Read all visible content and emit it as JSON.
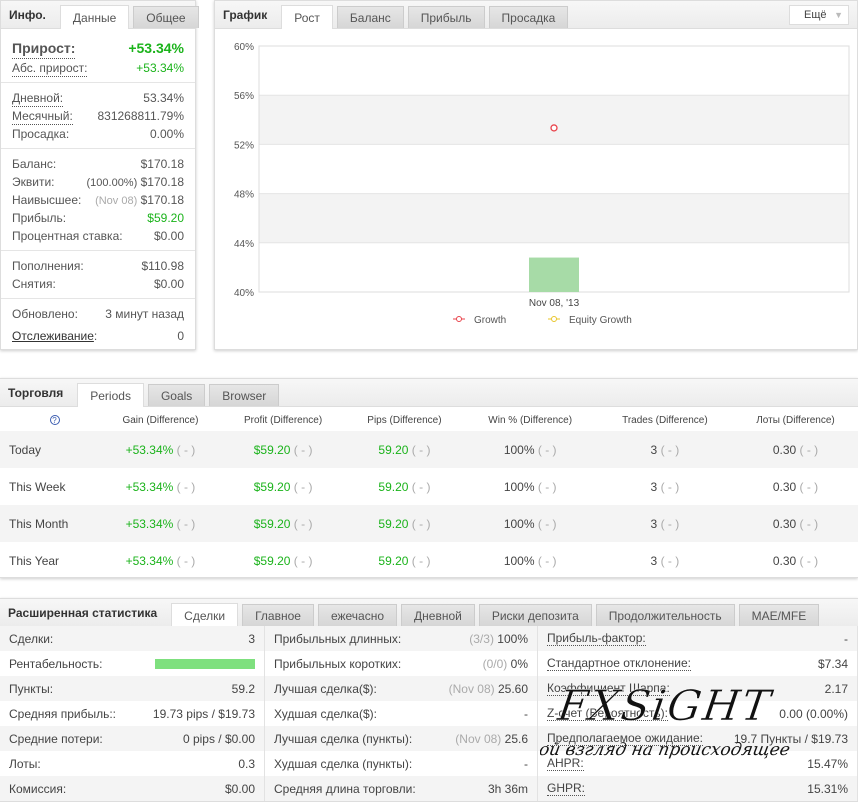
{
  "info": {
    "title": "Инфо.",
    "tabs": [
      "Данные",
      "Общее"
    ],
    "growth_label": "Прирост:",
    "growth_value": "+53.34%",
    "abs_label": "Абс. прирост:",
    "abs_value": "+53.34%",
    "rows1": [
      {
        "l": "Дневной:",
        "v": "53.34%"
      },
      {
        "l": "Месячный:",
        "v": "831268811.79%"
      },
      {
        "l": "Просадка:",
        "v": "0.00%"
      }
    ],
    "balance_label": "Баланс:",
    "balance": "$170.18",
    "equity_label": "Эквити:",
    "equity_pct": "(100.00%)",
    "equity": "$170.18",
    "high_label": "Наивысшее:",
    "high_date": "(Nov 08)",
    "high": "$170.18",
    "profit_label": "Прибыль:",
    "profit": "$59.20",
    "interest_label": "Процентная ставка:",
    "interest": "$0.00",
    "deposits_label": "Пополнения:",
    "deposits": "$110.98",
    "withdrawals_label": "Снятия:",
    "withdrawals": "$0.00",
    "updated_label": "Обновлено:",
    "updated": "3 минут назад",
    "tracking_label": "Отслеживание",
    "tracking": "0"
  },
  "chart": {
    "title": "График",
    "tabs": [
      "Рост",
      "Баланс",
      "Прибыль",
      "Просадка"
    ],
    "more": "Ещё"
  },
  "chart_data": {
    "type": "line",
    "yticks": [
      "60%",
      "56%",
      "52%",
      "48%",
      "44%",
      "40%"
    ],
    "ylim": [
      40,
      60
    ],
    "categories": [
      "Nov 08, '13"
    ],
    "series": [
      {
        "name": "Growth",
        "values": [
          53.34
        ],
        "color": "#e8424a"
      },
      {
        "name": "Equity Growth",
        "values": [],
        "color": "#e8c52a"
      }
    ],
    "bar": {
      "value": 42.8,
      "color": "#a7dba7"
    }
  },
  "trading": {
    "title": "Торговля",
    "tabs": [
      "Periods",
      "Goals",
      "Browser"
    ],
    "help": "?",
    "headers": [
      "Gain (Difference)",
      "Profit (Difference)",
      "Pips (Difference)",
      "Win % (Difference)",
      "Trades (Difference)",
      "Лоты (Difference)"
    ],
    "diff": "( - )",
    "rows": [
      {
        "period": "Today",
        "gain": "+53.34%",
        "profit": "$59.20",
        "pips": "59.20",
        "win": "100%",
        "trades": "3",
        "lots": "0.30"
      },
      {
        "period": "This Week",
        "gain": "+53.34%",
        "profit": "$59.20",
        "pips": "59.20",
        "win": "100%",
        "trades": "3",
        "lots": "0.30"
      },
      {
        "period": "This Month",
        "gain": "+53.34%",
        "profit": "$59.20",
        "pips": "59.20",
        "win": "100%",
        "trades": "3",
        "lots": "0.30"
      },
      {
        "period": "This Year",
        "gain": "+53.34%",
        "profit": "$59.20",
        "pips": "59.20",
        "win": "100%",
        "trades": "3",
        "lots": "0.30"
      }
    ]
  },
  "ext": {
    "title": "Расширенная статистика",
    "tabs": [
      "Сделки",
      "Главное",
      "ежечасно",
      "Дневной",
      "Риски депозита",
      "Продолжительность",
      "MAE/MFE"
    ],
    "col1": [
      {
        "l": "Сделки:",
        "v": "3"
      },
      {
        "l": "Рентабельность:",
        "bar": 1.0
      },
      {
        "l": "Пункты:",
        "v": "59.2"
      },
      {
        "l": "Средняя прибыль::",
        "v": "19.73 pips / $19.73"
      },
      {
        "l": "Средние потери:",
        "v": "0 pips / $0.00"
      },
      {
        "l": "Лоты:",
        "v": "0.3"
      },
      {
        "l": "Комиссия:",
        "v": "$0.00"
      }
    ],
    "col2": [
      {
        "l": "Прибыльных длинных:",
        "m": "(3/3)",
        "v": "100%"
      },
      {
        "l": "Прибыльных коротких:",
        "m": "(0/0)",
        "v": "0%"
      },
      {
        "l": "Лучшая сделка($):",
        "m": "(Nov 08)",
        "v": "25.60"
      },
      {
        "l": "Худшая сделка($):",
        "v": "-"
      },
      {
        "l": "Лучшая сделка (пункты):",
        "m": "(Nov 08)",
        "v": "25.6"
      },
      {
        "l": "Худшая сделка (пункты):",
        "v": "-"
      },
      {
        "l": "Средняя длина торговли:",
        "v": "3h 36m"
      }
    ],
    "col3": [
      {
        "l": "Прибыль-фактор:",
        "v": "-"
      },
      {
        "l": "Стандартное отклонение:",
        "v": "$7.34"
      },
      {
        "l": "Коэффициент Шарпа:",
        "v": "2.17"
      },
      {
        "l": "Z-счет (Вероятность):",
        "v": "0.00 (0.00%)"
      },
      {
        "l": "Предполагаемое ожидание:",
        "v": "19.7 Пункты / $19.73"
      },
      {
        "l": "AHPR:",
        "v": "15.47%"
      },
      {
        "l": "GHPR:",
        "v": "15.31%"
      }
    ]
  },
  "watermark": {
    "brand": "FXSiGHT",
    "tagline": "свой взгляд на происходящее"
  }
}
